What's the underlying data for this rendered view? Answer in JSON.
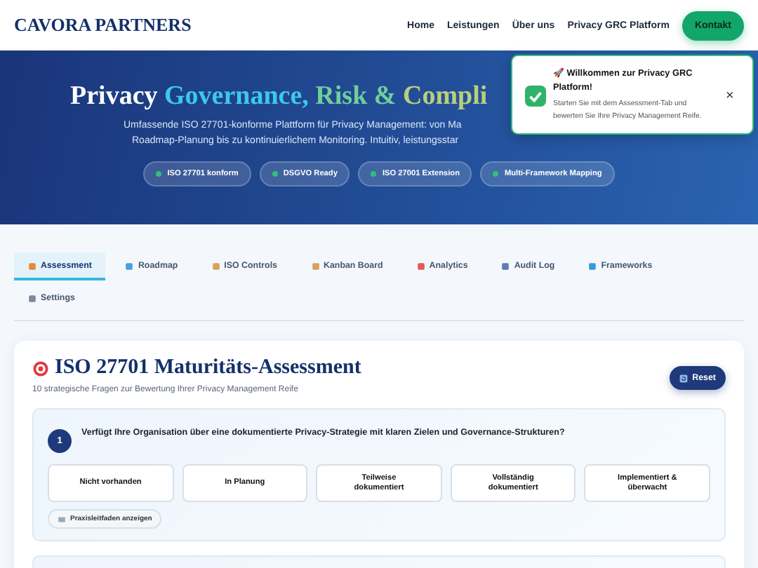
{
  "nav": {
    "logo": "CAVORA PARTNERS",
    "links": [
      "Home",
      "Leistungen",
      "Über uns",
      "Privacy GRC Platform"
    ],
    "cta": "Kontakt"
  },
  "hero": {
    "title": [
      {
        "text": "Privacy",
        "color": "#ffffff"
      },
      {
        "text": "Governance,",
        "color": "#3cc8ee"
      },
      {
        "text": "Risk &",
        "color": "#6fcf9a"
      },
      {
        "text": "Compli",
        "color": "#b9cf7a"
      }
    ],
    "subtitle_lines": [
      "Umfassende ISO 27701-konforme Plattform für Privacy Management: von Ma",
      "Roadmap-Planung bis zu kontinuierlichem Monitoring. Intuitiv, leistungsstar"
    ],
    "badges": [
      "ISO 27701 konform",
      "DSGVO Ready",
      "ISO 27001 Extension",
      "Multi-Framework Mapping"
    ]
  },
  "toast": {
    "title": "🚀 Willkommen zur Privacy GRC Platform!",
    "message": "Starten Sie mit dem Assessment-Tab und bewerten Sie Ihre Privacy Management Reife.",
    "close": "×"
  },
  "tabs": [
    {
      "label": "Assessment",
      "selected": true
    },
    {
      "label": "Roadmap",
      "selected": false
    },
    {
      "label": "ISO Controls",
      "selected": false
    },
    {
      "label": "Kanban Board",
      "selected": false
    },
    {
      "label": "Analytics",
      "selected": false
    },
    {
      "label": "Audit Log",
      "selected": false
    },
    {
      "label": "Frameworks",
      "selected": false
    },
    {
      "label": "Settings",
      "selected": false
    }
  ],
  "assessment": {
    "title": "ISO 27701 Maturitäts-Assessment",
    "subtitle": "10 strategische Fragen zur Bewertung Ihrer Privacy Management Reife",
    "reset": "Reset",
    "questions": [
      {
        "number": "1",
        "text": "Verfügt Ihre Organisation über eine dokumentierte Privacy-Strategie mit klaren Zielen und Governance-Strukturen?",
        "options": [
          {
            "label": "Nicht vorhanden",
            "selected": false
          },
          {
            "label": "In Planung",
            "selected": false
          },
          {
            "label": "Teilweise dokumentiert",
            "selected": false
          },
          {
            "label": "Vollständig dokumentiert",
            "selected": false
          },
          {
            "label": "Implementiert & überwacht",
            "selected": false
          }
        ],
        "guide": "Praxisleitfaden anzeigen"
      }
    ]
  }
}
